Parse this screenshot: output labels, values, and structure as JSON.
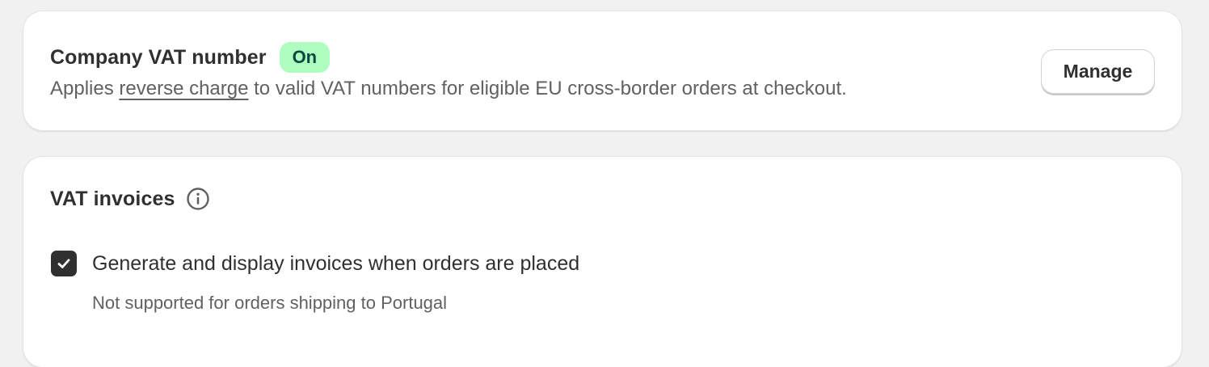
{
  "vat_number": {
    "title": "Company VAT number",
    "status_badge": "On",
    "description_prefix": "Applies ",
    "description_link": "reverse charge",
    "description_suffix": " to valid VAT numbers for eligible EU cross-border orders at checkout.",
    "manage_label": "Manage"
  },
  "vat_invoices": {
    "title": "VAT invoices",
    "info_icon": "info-icon",
    "checkbox": {
      "checked": true,
      "label": "Generate and display invoices when orders are placed",
      "help_text": "Not supported for orders shipping to Portugal"
    }
  },
  "colors": {
    "badge_bg": "#affebf",
    "badge_text": "#014b40",
    "checkbox_bg": "#303030",
    "page_bg": "#f1f1f1"
  }
}
